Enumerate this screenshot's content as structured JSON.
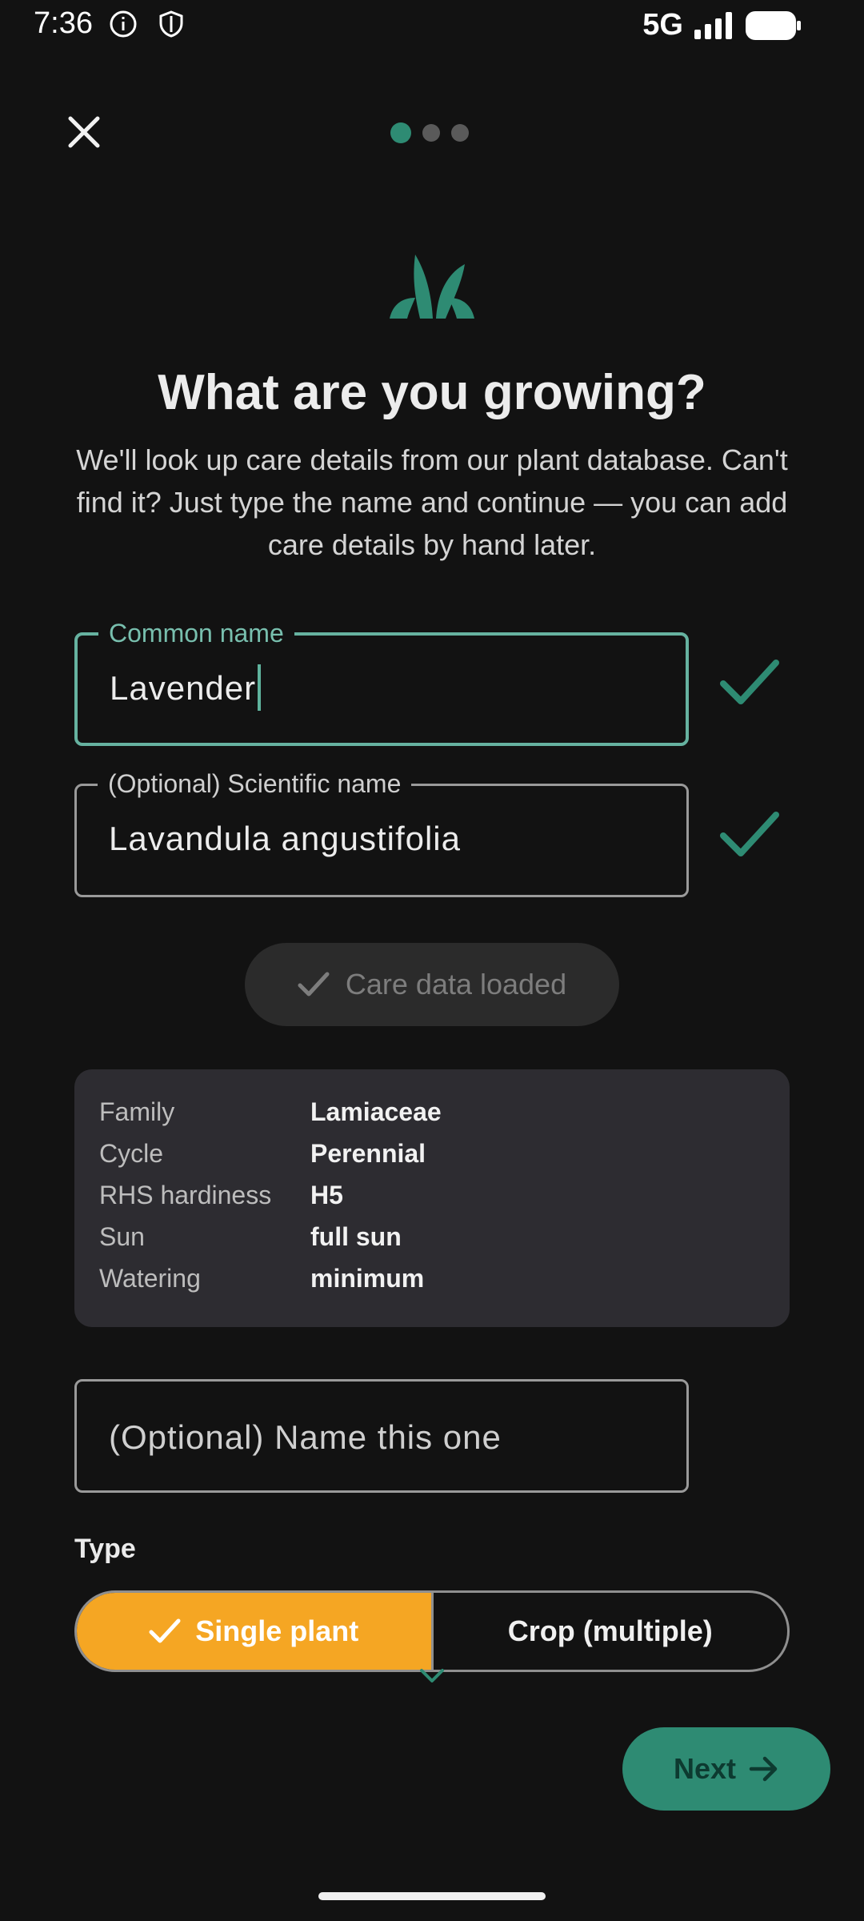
{
  "status_bar": {
    "time": "7:36",
    "network": "5G",
    "icons": [
      "info-icon",
      "shield-icon",
      "signal-icon",
      "battery-icon"
    ]
  },
  "header": {
    "close_icon": "close-icon",
    "steps_total": 3,
    "step_current": 1
  },
  "hero": {
    "icon": "sprout-icon",
    "title": "What are you growing?",
    "subtitle": "We'll look up care details from our plant database. Can't find it? Just type the name and continue — you can add care details by hand later."
  },
  "form": {
    "common_name": {
      "label": "Common name",
      "value": "Lavender",
      "status_icon": "check-icon"
    },
    "scientific_name": {
      "label": "(Optional) Scientific name",
      "value": "Lavandula angustifolia",
      "status_icon": "check-icon"
    },
    "care_chip": {
      "label": "Care data loaded",
      "icon": "check-icon"
    },
    "care_details": [
      {
        "key": "Family",
        "value": "Lamiaceae"
      },
      {
        "key": "Cycle",
        "value": "Perennial"
      },
      {
        "key": "RHS hardiness",
        "value": "H5"
      },
      {
        "key": "Sun",
        "value": "full sun"
      },
      {
        "key": "Watering",
        "value": "minimum"
      }
    ],
    "nickname": {
      "placeholder": "(Optional) Name this one"
    },
    "type": {
      "label": "Type",
      "options": [
        {
          "label": "Single plant",
          "selected": true
        },
        {
          "label": "Crop (multiple)",
          "selected": false
        }
      ]
    }
  },
  "footer": {
    "next_label": "Next",
    "next_icon": "arrow-right-icon"
  },
  "colors": {
    "background": "#121212",
    "accent": "#2e8b73",
    "focus_outline": "#66b2a0",
    "selected_segment": "#f5a623",
    "card": "#2d2c31"
  }
}
